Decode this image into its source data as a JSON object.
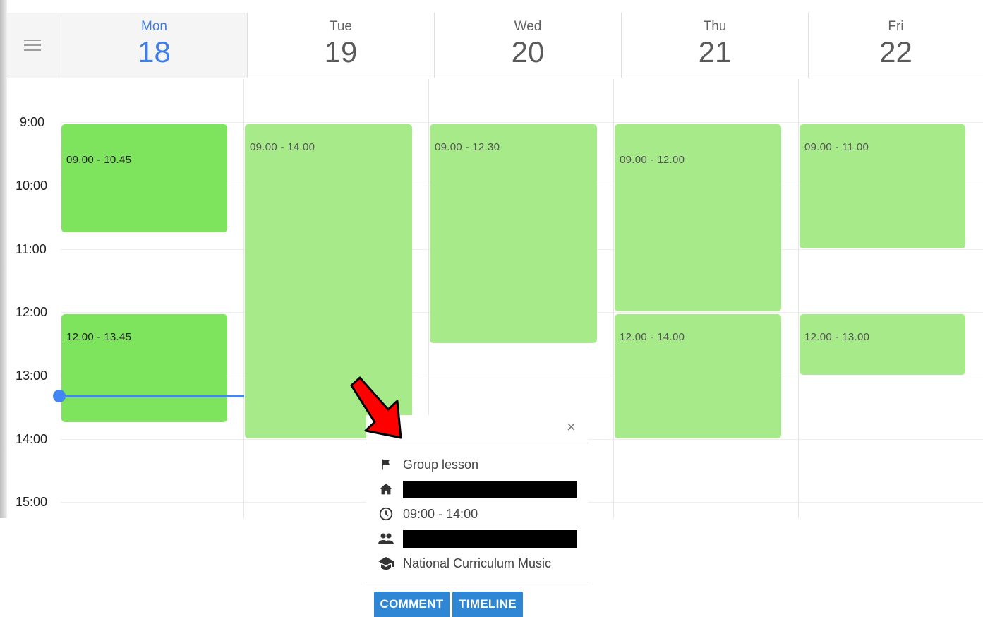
{
  "header": {
    "days": [
      {
        "name": "Mon",
        "num": "18",
        "today": true
      },
      {
        "name": "Tue",
        "num": "19",
        "today": false
      },
      {
        "name": "Wed",
        "num": "20",
        "today": false
      },
      {
        "name": "Thu",
        "num": "21",
        "today": false
      },
      {
        "name": "Fri",
        "num": "22",
        "today": false
      }
    ]
  },
  "times": [
    "9:00",
    "10:00",
    "11:00",
    "12:00",
    "13:00",
    "14:00",
    "15:00"
  ],
  "events": {
    "mon1": "09.00 - 10.45",
    "mon2": "12.00 - 13.45",
    "tue1": "09.00 - 14.00",
    "wed1": "09.00 - 12.30",
    "thu1": "09.00 - 12.00",
    "thu2": "12.00 - 14.00",
    "fri1": "09.00 - 11.00",
    "fri2": "12.00 - 13.00"
  },
  "popup": {
    "close": "×",
    "type": "Group lesson",
    "time": "09:00 - 14:00",
    "subject": "National Curriculum Music",
    "comment_label": "COMMENT",
    "timeline_label": "TIMELINE"
  },
  "colors": {
    "today_blue": "#3f7ee8",
    "event_light": "#a6ea8a",
    "event_strong": "#7ee35d",
    "now_line": "#4285f4",
    "button": "#2e86d4",
    "arrow": "#ff0000"
  },
  "icons": {
    "menu": "menu-icon",
    "flag": "flag-icon",
    "home": "home-icon",
    "clock": "clock-icon",
    "people": "people-icon",
    "graduation": "graduation-cap-icon"
  }
}
